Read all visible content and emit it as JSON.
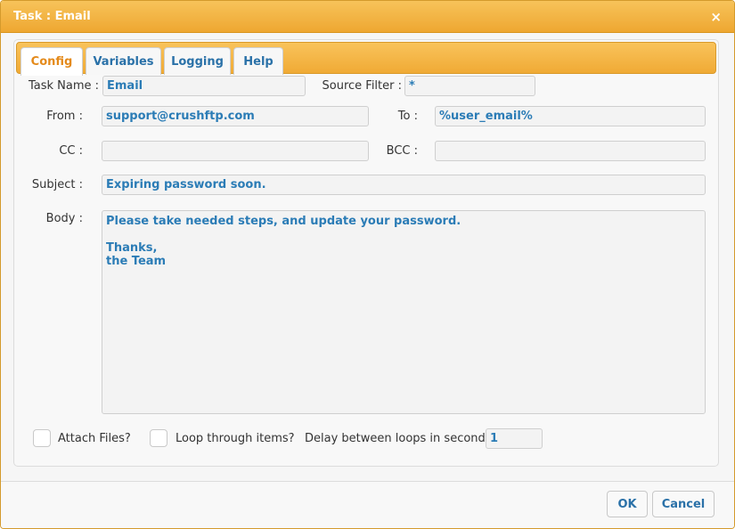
{
  "window": {
    "title": "Task : Email",
    "close_icon": "×"
  },
  "tabs": [
    {
      "label": "Config",
      "active": true
    },
    {
      "label": "Variables",
      "active": false
    },
    {
      "label": "Logging",
      "active": false
    },
    {
      "label": "Help",
      "active": false
    }
  ],
  "form": {
    "task_name_label": "Task Name :",
    "task_name_value": "Email",
    "source_filter_label": "Source Filter :",
    "source_filter_value": "*",
    "from_label": "From :",
    "from_value": "support@crushftp.com",
    "to_label": "To :",
    "to_value": "%user_email%",
    "cc_label": "CC :",
    "cc_value": "",
    "bcc_label": "BCC :",
    "bcc_value": "",
    "subject_label": "Subject :",
    "subject_value": "Expiring password soon.",
    "body_label": "Body :",
    "body_value": "Please take needed steps, and update your password.\n\nThanks,\nthe Team",
    "attach_files_label": "Attach Files?",
    "attach_files_checked": false,
    "loop_items_label": "Loop through items?",
    "loop_items_checked": false,
    "delay_label": "Delay between loops in seconds :",
    "delay_value": "1"
  },
  "footer": {
    "ok_label": "OK",
    "cancel_label": "Cancel"
  },
  "colors": {
    "accent": "#f0aa35",
    "link_text": "#2a71a8",
    "active_tab_text": "#e48a1b"
  }
}
